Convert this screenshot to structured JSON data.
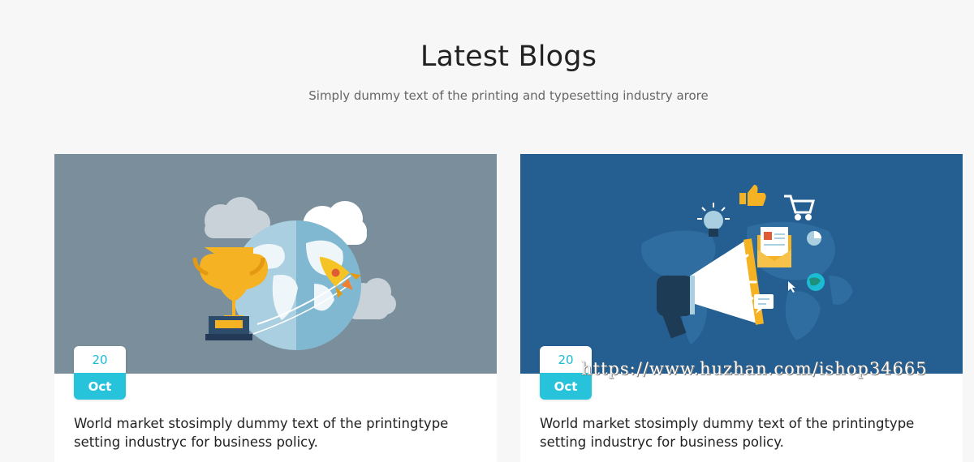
{
  "section": {
    "title": "Latest Blogs",
    "subtitle": "Simply dummy text of the printing and typesetting industry arore"
  },
  "posts": [
    {
      "day": "20",
      "month": "Oct",
      "title": "World market stosimply dummy text of the printingtype setting industryc for business policy.",
      "image_icon": "trophy-globe-rocket-illustration",
      "image_bg": "#7a8f9b"
    },
    {
      "day": "20",
      "month": "Oct",
      "title": "World market stosimply dummy text of the printingtype setting industryc for business policy.",
      "image_icon": "megaphone-marketing-illustration",
      "image_bg": "#255f91"
    }
  ],
  "watermark": "https://www.huzhan.com/ishop34665",
  "colors": {
    "accent": "#26c3da",
    "accent_text": "#1bbbd3"
  }
}
